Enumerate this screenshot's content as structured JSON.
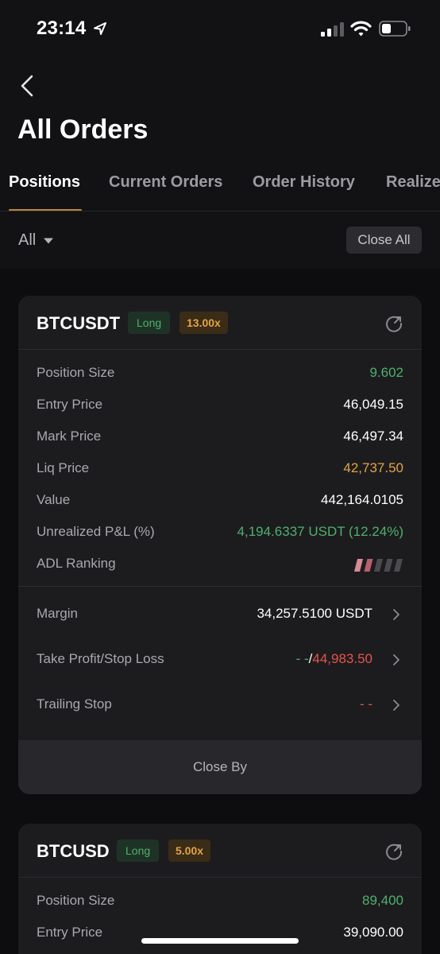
{
  "status_bar": {
    "time": "23:14"
  },
  "header": {
    "title": "All Orders"
  },
  "tabs": [
    {
      "label": "Positions"
    },
    {
      "label": "Current Orders"
    },
    {
      "label": "Order History"
    },
    {
      "label": "Realize"
    }
  ],
  "filter": {
    "selected": "All",
    "close_all_label": "Close All"
  },
  "positions": [
    {
      "symbol": "BTCUSDT",
      "side": "Long",
      "leverage": "13.00x",
      "rows": [
        {
          "label": "Position Size",
          "value": "9.602"
        },
        {
          "label": "Entry Price",
          "value": "46,049.15"
        },
        {
          "label": "Mark Price",
          "value": "46,497.34"
        },
        {
          "label": "Liq Price",
          "value": "42,737.50"
        },
        {
          "label": "Value",
          "value": "442,164.0105"
        },
        {
          "label": "Unrealized P&L (%)",
          "value": "4,194.6337 USDT (12.24%)"
        },
        {
          "label": "ADL Ranking",
          "value": ""
        }
      ],
      "adl_level": 2,
      "adl_max": 5,
      "margin": {
        "label": "Margin",
        "value": "34,257.5100 USDT"
      },
      "tpsl": {
        "label": "Take Profit/Stop Loss",
        "tp": "- -",
        "separator": "/",
        "sl": "44,983.50"
      },
      "trailing": {
        "label": "Trailing Stop",
        "value": "- -"
      },
      "close_by_label": "Close By"
    },
    {
      "symbol": "BTCUSD",
      "side": "Long",
      "leverage": "5.00x",
      "rows": [
        {
          "label": "Position Size",
          "value": "89,400"
        },
        {
          "label": "Entry Price",
          "value": "39,090.00"
        }
      ]
    }
  ],
  "colors": {
    "accent": "#b8863f",
    "long_green": "#4fb06c",
    "leverage_orange": "#e3a345",
    "loss_red": "#e5534b",
    "background": "#121214",
    "card": "#1c1c1f"
  }
}
